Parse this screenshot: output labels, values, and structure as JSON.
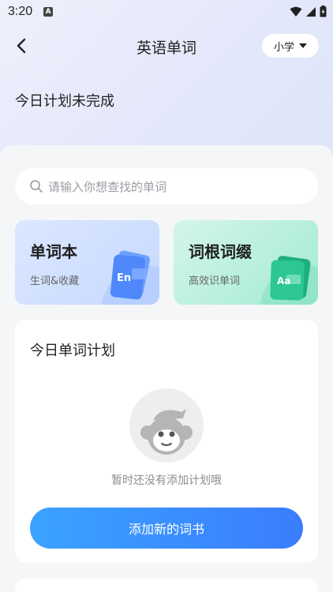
{
  "status_bar": {
    "time": "3:20",
    "notification_icon": "A"
  },
  "nav": {
    "title": "英语单词",
    "grade_selector": "小学"
  },
  "plan_status": "今日计划未完成",
  "search": {
    "placeholder": "请输入你想查找的单词"
  },
  "cards": [
    {
      "title": "单词本",
      "subtitle": "生词&收藏",
      "badge": "En"
    },
    {
      "title": "词根词缀",
      "subtitle": "高效识单词",
      "badge": "Aa"
    }
  ],
  "daily_plan": {
    "title": "今日单词计划",
    "empty_text": "暂时还没有添加计划哦",
    "add_button": "添加新的词书"
  },
  "colors": {
    "primary_blue": "#3b8bff",
    "vocab_card": "#c7d9ff",
    "root_card": "#a3ebd3"
  }
}
